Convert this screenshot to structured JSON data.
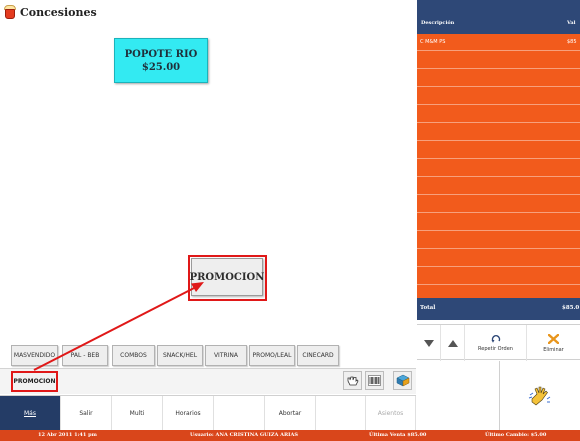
{
  "app": {
    "title": "Concesiones"
  },
  "products": [
    {
      "name": "POPOTE RIO",
      "price": "$25.00",
      "color": "#33eaf2"
    },
    {
      "name": "PROMOCION"
    }
  ],
  "categories": [
    "MASVENDIDO",
    "PAL - BEB",
    "COMBOS",
    "SNACK/HEL",
    "VITRINA",
    "PROMO/LEAL",
    "CINECARD"
  ],
  "selected_category": "PROMOCION",
  "tools": [
    "hand-cursor-icon",
    "barcode-icon",
    "box-icon"
  ],
  "menu": {
    "items": [
      "Más",
      "Salir",
      "Multi",
      "Horarios",
      "",
      "Abortar",
      "",
      "Asientos"
    ]
  },
  "order": {
    "columns": [
      "Descripción",
      "Val"
    ],
    "items": [
      {
        "description": "C M&M PS",
        "value": "$85"
      }
    ],
    "total_label": "Total",
    "total_value": "$85.0"
  },
  "actions": {
    "down_label": "",
    "up_label": "",
    "repeat_label": "Repetir Orden",
    "delete_label": "Eliminar"
  },
  "status": {
    "datetime": "12 Abr 2011 1:41 pm",
    "user": "Usuario: ANA CRISTINA GUIZA ARIAS",
    "last_sale": "Última Venta $85.00",
    "last_change": "Último Cambio: $5.00"
  },
  "colors": {
    "accent_orange": "#f25b1c",
    "header_navy": "#2e4877",
    "status_bar": "#d9461b",
    "highlight_red": "#e01818"
  }
}
